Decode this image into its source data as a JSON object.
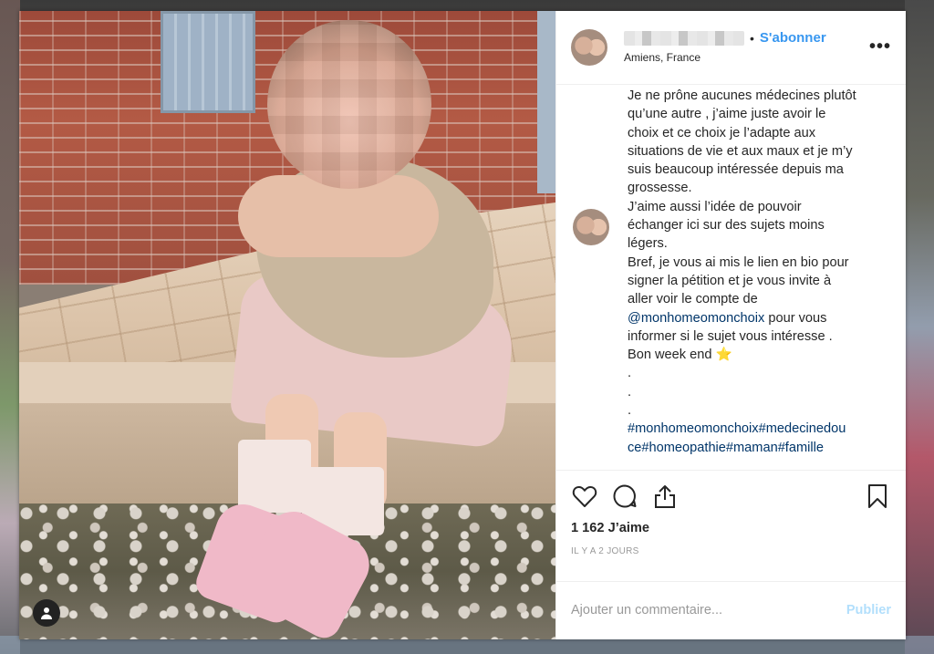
{
  "post": {
    "location": "Amiens, France",
    "follow_label": "S'abonner",
    "separator": "•",
    "more_label": "•••"
  },
  "caption": {
    "lines": [
      "Je ne prône aucunes médecines plutôt",
      "qu’une autre , j’aime juste avoir le",
      "choix et ce choix je l’adapte aux",
      "situations de vie et aux maux et je m’y",
      "suis beaucoup intéressée depuis ma",
      "grossesse.",
      "J’aime aussi l’idée de pouvoir",
      "échanger ici sur des sujets moins",
      "légers.",
      "Bref, je vous ai mis le lien en bio pour",
      "signer la pétition et je vous invite à",
      "aller voir le compte de"
    ],
    "mention": "@monhomeomonchoix",
    "mention_after": " pour vous",
    "line_after_mention": "informer si le sujet vous intéresse .",
    "closing": "Bon week end ",
    "star": "⭐",
    "dots": [
      ".",
      ".",
      "."
    ],
    "hashtags_line1": "#monhomeomonchoix#medecinedou",
    "hashtags_line2": "ce#homeopathie#maman#famille"
  },
  "stats": {
    "likes": "1 162 J’aime",
    "time": "IL Y A 2 JOURS"
  },
  "comment": {
    "placeholder": "Ajouter un commentaire...",
    "publish_label": "Publier"
  },
  "icons": {
    "like": "heart-icon",
    "comment": "comment-icon",
    "share": "share-icon",
    "save": "bookmark-icon",
    "user_tag": "user-tag-icon"
  },
  "colors": {
    "accent": "#3897f0",
    "hashtag": "#003569",
    "publish_disabled": "#b2dffc"
  }
}
